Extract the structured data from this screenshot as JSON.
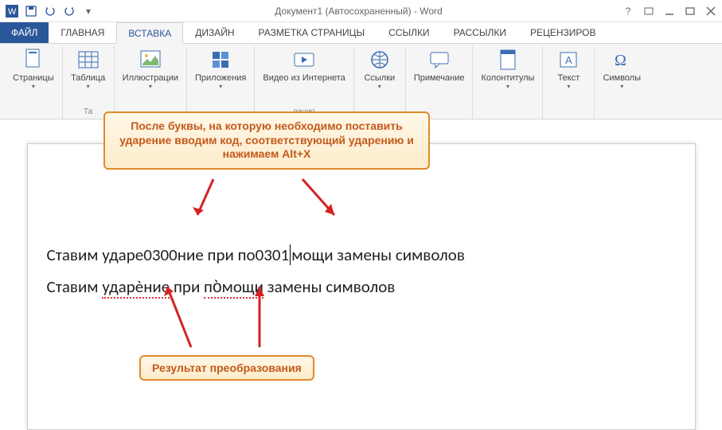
{
  "titlebar": {
    "title": "Документ1 (Автосохраненный) - Word"
  },
  "tabs": {
    "file": "ФАЙЛ",
    "items": [
      "ГЛАВНАЯ",
      "ВСТАВКА",
      "ДИЗАЙН",
      "РАЗМЕТКА СТРАНИЦЫ",
      "ССЫЛКИ",
      "РАССЫЛКИ",
      "РЕЦЕНЗИРОВ"
    ]
  },
  "ribbon": {
    "groups": [
      {
        "label": "Страницы",
        "gname": ""
      },
      {
        "label": "Таблица",
        "gname": "Та"
      },
      {
        "label": "Иллюстрации",
        "gname": ""
      },
      {
        "label": "Приложения",
        "gname": ""
      },
      {
        "label": "Видео из Интернета",
        "gname": "вания"
      },
      {
        "label": "Ссылки",
        "gname": ""
      },
      {
        "label": "Примечание",
        "gname": ""
      },
      {
        "label": "Колонтитулы",
        "gname": ""
      },
      {
        "label": "Текст",
        "gname": ""
      },
      {
        "label": "Символы",
        "gname": ""
      }
    ]
  },
  "callouts": {
    "top": "После буквы, на которую необходимо поставить ударение вводим код, соответствующий ударению и нажимаем Alt+X",
    "bottom": "Результат преобразования"
  },
  "doc": {
    "line1_a": "Ставим ударе0300ние при по0301",
    "line1_b": "мощи замены символов",
    "line2_a": "Ставим ",
    "line2_sp1": "ударѐние",
    "line2_b": " при ",
    "line2_sp2": "по̀мощи",
    "line2_c": " замены символов"
  }
}
